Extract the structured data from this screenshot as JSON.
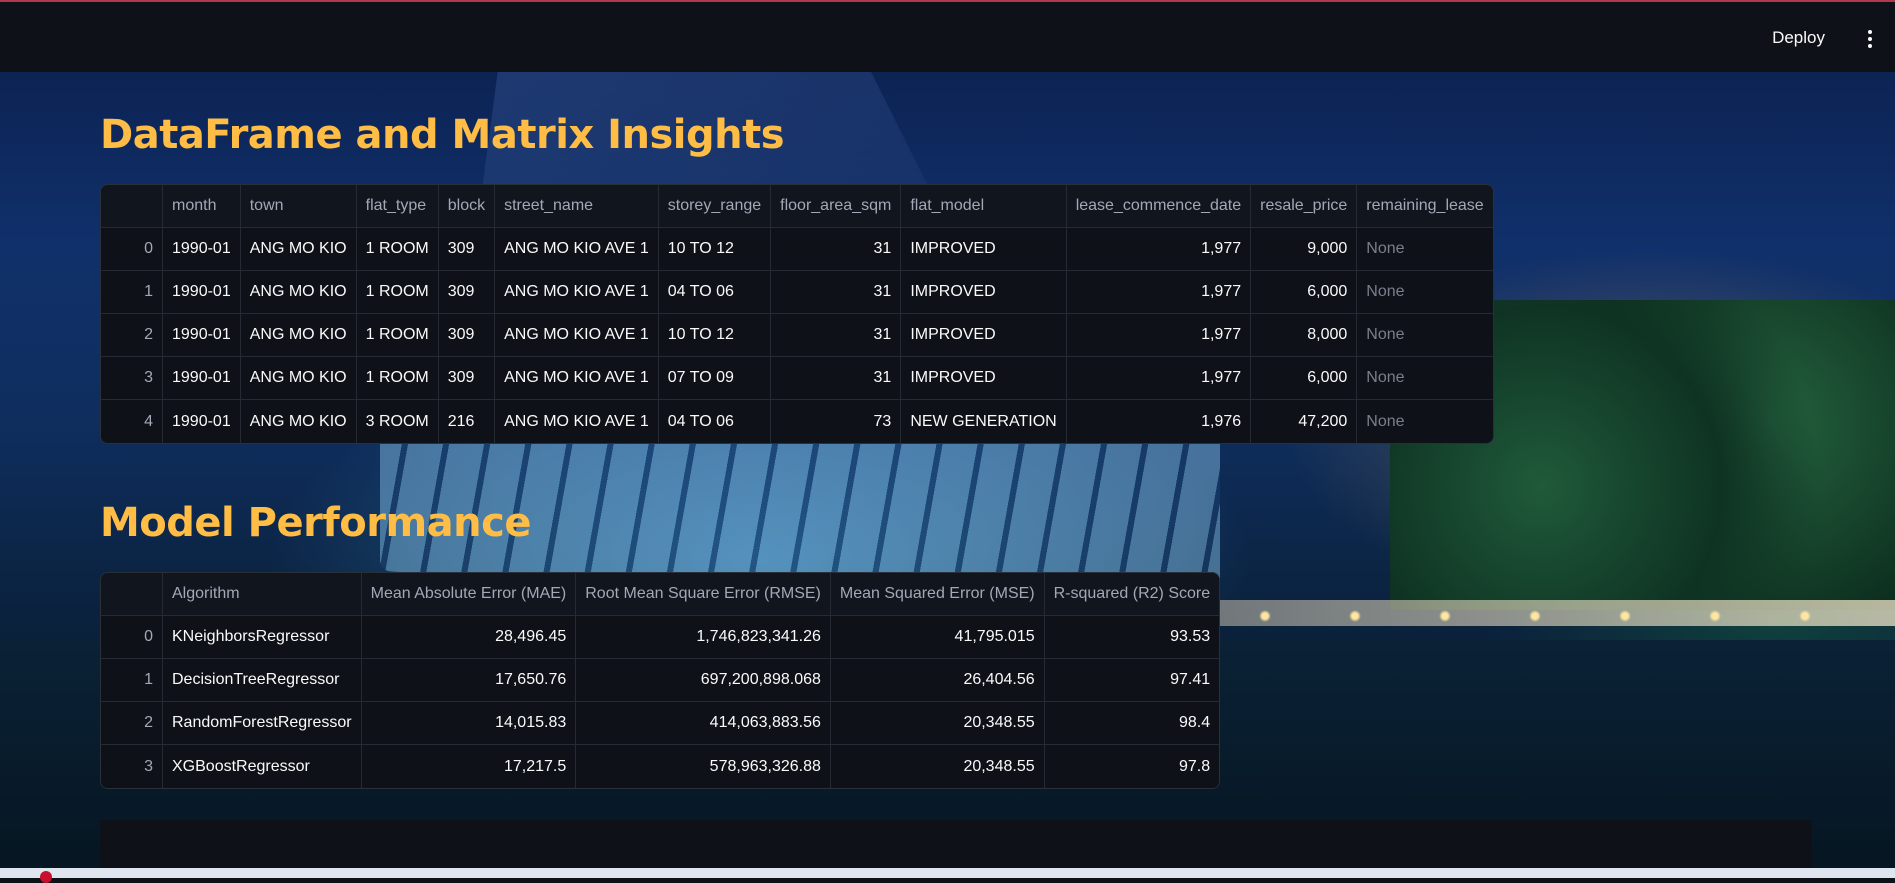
{
  "header": {
    "deploy_label": "Deploy",
    "menu_icon": "kebab-menu-icon"
  },
  "sections": {
    "insights_title": "DataFrame and Matrix Insights",
    "model_title": "Model Performance"
  },
  "dataframe": {
    "columns": [
      "",
      "month",
      "town",
      "flat_type",
      "block",
      "street_name",
      "storey_range",
      "floor_area_sqm",
      "flat_model",
      "lease_commence_date",
      "resale_price",
      "remaining_lease"
    ],
    "rows": [
      [
        "0",
        "1990-01",
        "ANG MO KIO",
        "1 ROOM",
        "309",
        "ANG MO KIO AVE 1",
        "10 TO 12",
        "31",
        "IMPROVED",
        "1,977",
        "9,000",
        "None"
      ],
      [
        "1",
        "1990-01",
        "ANG MO KIO",
        "1 ROOM",
        "309",
        "ANG MO KIO AVE 1",
        "04 TO 06",
        "31",
        "IMPROVED",
        "1,977",
        "6,000",
        "None"
      ],
      [
        "2",
        "1990-01",
        "ANG MO KIO",
        "1 ROOM",
        "309",
        "ANG MO KIO AVE 1",
        "10 TO 12",
        "31",
        "IMPROVED",
        "1,977",
        "8,000",
        "None"
      ],
      [
        "3",
        "1990-01",
        "ANG MO KIO",
        "1 ROOM",
        "309",
        "ANG MO KIO AVE 1",
        "07 TO 09",
        "31",
        "IMPROVED",
        "1,977",
        "6,000",
        "None"
      ],
      [
        "4",
        "1990-01",
        "ANG MO KIO",
        "3 ROOM",
        "216",
        "ANG MO KIO AVE 1",
        "04 TO 06",
        "73",
        "NEW GENERATION",
        "1,976",
        "47,200",
        "None"
      ]
    ]
  },
  "model_performance": {
    "columns": [
      "",
      "Algorithm",
      "Mean Absolute Error (MAE)",
      "Root Mean Square Error (RMSE)",
      "Mean Squared Error (MSE)",
      "R-squared (R2) Score"
    ],
    "rows": [
      [
        "0",
        "KNeighborsRegressor",
        "28,496.45",
        "1,746,823,341.26",
        "41,795.015",
        "93.53"
      ],
      [
        "1",
        "DecisionTreeRegressor",
        "17,650.76",
        "697,200,898.068",
        "26,404.56",
        "97.41"
      ],
      [
        "2",
        "RandomForestRegressor",
        "14,015.83",
        "414,063,883.56",
        "20,348.55",
        "98.4"
      ],
      [
        "3",
        "XGBoostRegressor",
        "17,217.5",
        "578,963,326.88",
        "20,348.55",
        "97.8"
      ]
    ]
  },
  "colors": {
    "title": "#ffbd45",
    "app_background": "#0e1117",
    "header_text": "#a3a8b8"
  }
}
